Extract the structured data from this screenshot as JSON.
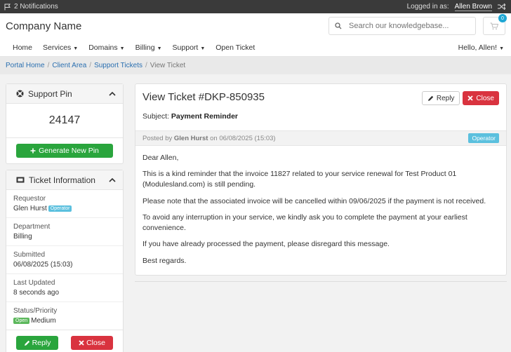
{
  "topbar": {
    "notifications": "2 Notifications",
    "logged_in_label": "Logged in as:",
    "user": "Allen Brown"
  },
  "header": {
    "brand": "Company Name",
    "search_placeholder": "Search our knowledgebase...",
    "cart_count": "0"
  },
  "nav": {
    "items": [
      {
        "label": "Home"
      },
      {
        "label": "Services"
      },
      {
        "label": "Domains"
      },
      {
        "label": "Billing"
      },
      {
        "label": "Support"
      },
      {
        "label": "Open Ticket"
      }
    ],
    "greeting": "Hello, Allen!"
  },
  "breadcrumb": {
    "items": [
      "Portal Home",
      "Client Area",
      "Support Tickets"
    ],
    "current": "View Ticket"
  },
  "support_pin": {
    "title": "Support Pin",
    "pin": "24147",
    "button": "Generate New Pin"
  },
  "ticket_info": {
    "title": "Ticket Information",
    "requestor_label": "Requestor",
    "requestor": "Glen Hurst",
    "requestor_badge": "Operator",
    "department_label": "Department",
    "department": "Billing",
    "submitted_label": "Submitted",
    "submitted": "06/08/2025 (15:03)",
    "updated_label": "Last Updated",
    "updated": "8 seconds ago",
    "status_label": "Status/Priority",
    "status": "Open",
    "priority": "Medium",
    "reply": "Reply",
    "close": "Close"
  },
  "ticket": {
    "title": "View Ticket #DKP-850935",
    "reply": "Reply",
    "close": "Close",
    "subject_label": "Subject:",
    "subject": "Payment Reminder",
    "posted_by": "Posted by",
    "author": "Glen Hurst",
    "on": "on",
    "date": "06/08/2025 (15:03)",
    "role": "Operator",
    "body": [
      "Dear Allen,",
      "This is a kind reminder that the invoice 11827 related to your service renewal for Test Product 01 (Modulesland.com) is still pending.",
      "Please note that the associated invoice will be cancelled within 09/06/2025 if the payment is not received.",
      "To avoid any interruption in your service, we kindly ask you to complete the payment at your earliest convenience.",
      "If you have already processed the payment, please disregard this message.",
      "Best regards."
    ]
  }
}
